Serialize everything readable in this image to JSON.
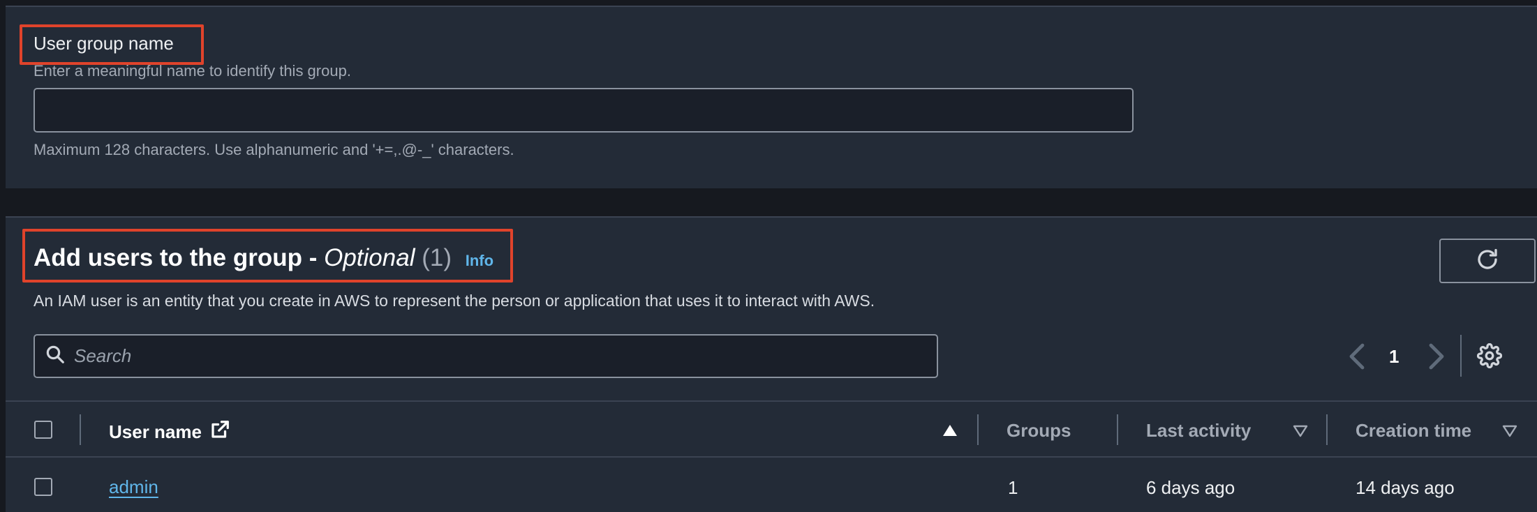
{
  "group_name_section": {
    "label": "User group name",
    "description": "Enter a meaningful name to identify this group.",
    "input_value": "",
    "hint": "Maximum 128 characters. Use alphanumeric and '+=,.@-_' characters."
  },
  "add_users_section": {
    "title": "Add users to the group - ",
    "title_optional": "Optional",
    "title_count": "(1)",
    "info_link": "Info",
    "description": "An IAM user is an entity that you create in AWS to represent the person or application that uses it to interact with AWS.",
    "search_placeholder": "Search",
    "pagination": {
      "current_page": "1"
    },
    "table": {
      "columns": [
        {
          "label": "User name",
          "sort": "ascending"
        },
        {
          "label": "Groups"
        },
        {
          "label": "Last activity",
          "sort": "sortable"
        },
        {
          "label": "Creation time",
          "sort": "sortable"
        }
      ],
      "rows": [
        {
          "user_name": "admin",
          "groups": "1",
          "last_activity": "6 days ago",
          "creation_time": "14 days ago"
        }
      ]
    }
  },
  "colors": {
    "highlight": "#e0432b",
    "link": "#60b6ea",
    "panel_bg": "#232b37",
    "page_bg": "#16191f"
  }
}
